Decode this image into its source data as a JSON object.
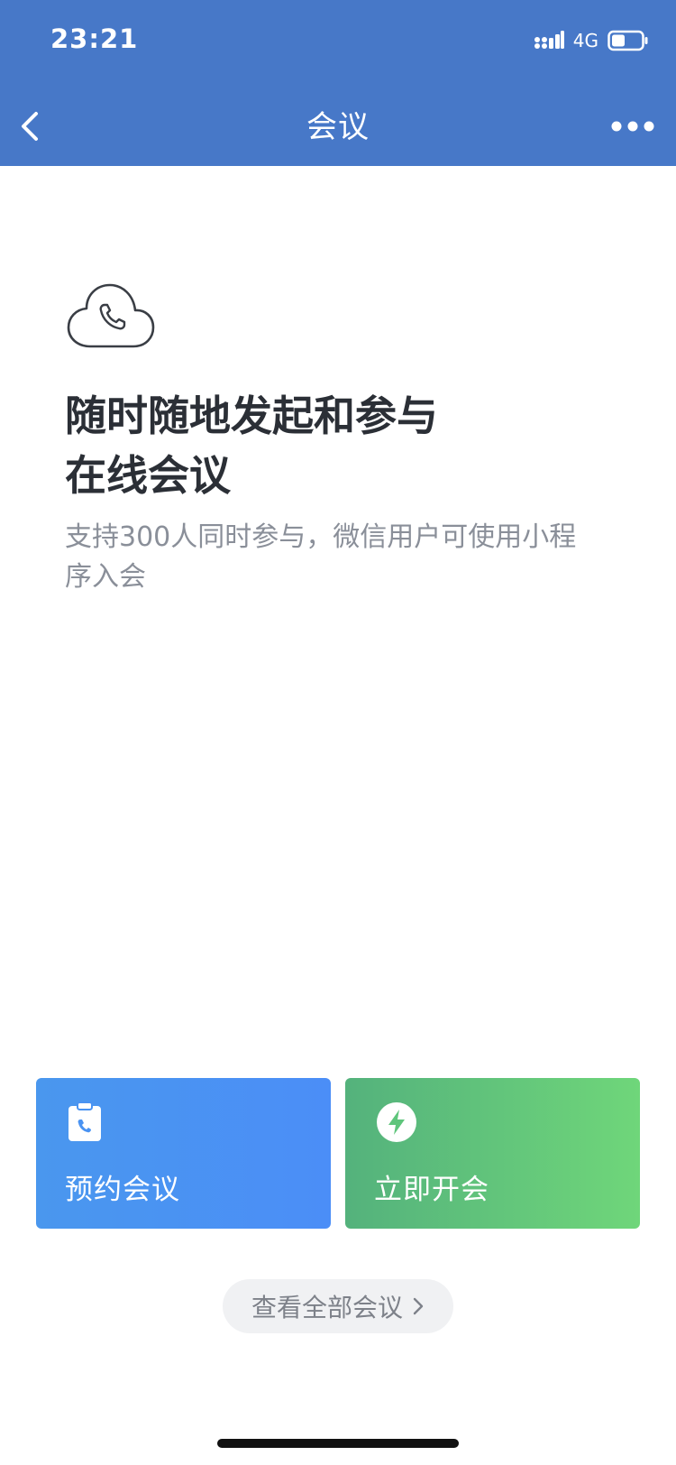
{
  "status_bar": {
    "time": "23:21",
    "network": "4G",
    "icons": [
      "signal-icon",
      "battery-icon"
    ]
  },
  "nav": {
    "title": "会议",
    "back_icon": "chevron-left-icon",
    "more_icon": "more-horizontal-icon"
  },
  "hero": {
    "icon": "cloud-phone-icon",
    "headline_line1": "随时随地发起和参与",
    "headline_line2": "在线会议",
    "subtitle_line1": "支持300人同时参与，微信用户可使用小程",
    "subtitle_line2": "序入会"
  },
  "actions": [
    {
      "label": "预约会议",
      "icon": "clipboard-phone-icon",
      "color": "#4a93f2"
    },
    {
      "label": "立即开会",
      "icon": "lightning-icon",
      "color": "#5ec57b"
    }
  ],
  "view_all": {
    "label": "查看全部会议",
    "icon": "chevron-right-icon"
  },
  "colors": {
    "header": "#4778c8",
    "text_primary": "#2b2f36",
    "text_secondary": "#8a8f99"
  }
}
